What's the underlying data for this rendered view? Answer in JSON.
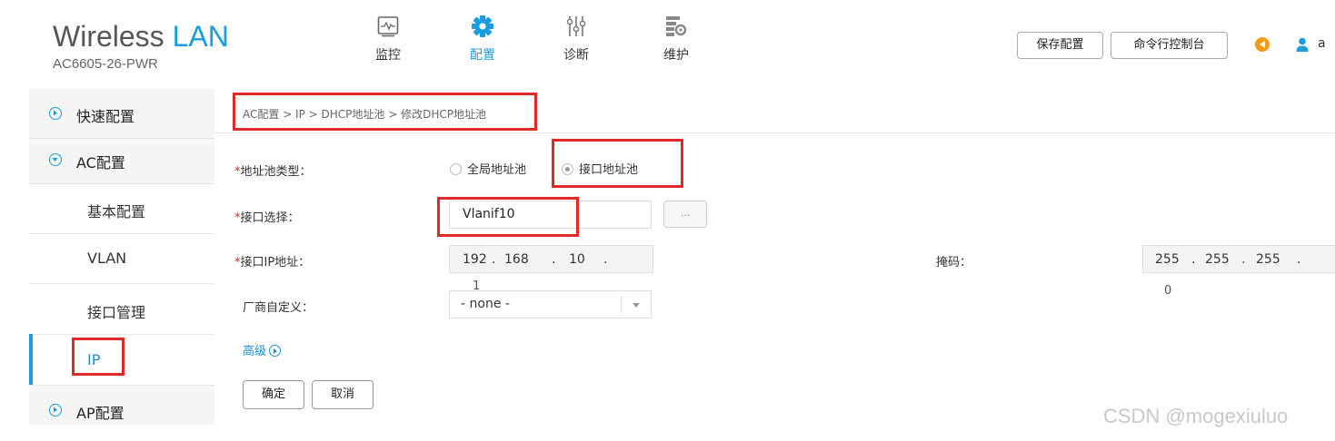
{
  "header": {
    "brand_word1": "Wireless",
    "brand_word2": "LAN",
    "model": "AC6605-26-PWR",
    "nav": [
      {
        "label": "监控",
        "icon": "monitor-icon",
        "active": false
      },
      {
        "label": "配置",
        "icon": "gear-icon",
        "active": true
      },
      {
        "label": "诊断",
        "icon": "sliders-icon",
        "active": false
      },
      {
        "label": "维护",
        "icon": "maintenance-icon",
        "active": false
      }
    ],
    "save_button": "保存配置",
    "cli_button": "命令行控制台",
    "user_name": "a",
    "colors": {
      "accent": "#1a9ce0",
      "speaker": "#f39a1b"
    }
  },
  "sidebar": {
    "items": [
      {
        "label": "快速配置",
        "icon": "expand-circle-icon",
        "expanded": false
      },
      {
        "label": "AC配置",
        "icon": "collapse-circle-icon",
        "expanded": true
      },
      {
        "label": "基本配置"
      },
      {
        "label": "VLAN"
      },
      {
        "label": "接口管理"
      },
      {
        "label": "IP",
        "selected": true
      },
      {
        "label": "AP配置",
        "icon": "expand-circle-icon",
        "expanded": false
      }
    ]
  },
  "breadcrumb": "AC配置 > IP > DHCP地址池 > 修改DHCP地址池",
  "form": {
    "required_mark": "*",
    "pool_type_label": "地址池类型：",
    "pool_type_options": [
      "全局地址池",
      "接口地址池"
    ],
    "pool_type_selected": "接口地址池",
    "interface_label": "接口选择：",
    "interface_value": "Vlanif10",
    "browse_button": "...",
    "ip_label": "接口IP地址：",
    "ip_octets": [
      "192",
      "168",
      "10",
      ""
    ],
    "ip_wrapped": "1",
    "ip_dot": ".",
    "mask_label": "掩码：",
    "mask_octets": [
      "255",
      "255",
      "255",
      ""
    ],
    "mask_wrapped": "0",
    "vendor_label": "厂商自定义：",
    "vendor_value": "- none -",
    "advanced_link": "高级",
    "ok_button": "确定",
    "cancel_button": "取消"
  },
  "watermark": "CSDN @mogexiuluo",
  "highlight_color": "#e02a2a"
}
